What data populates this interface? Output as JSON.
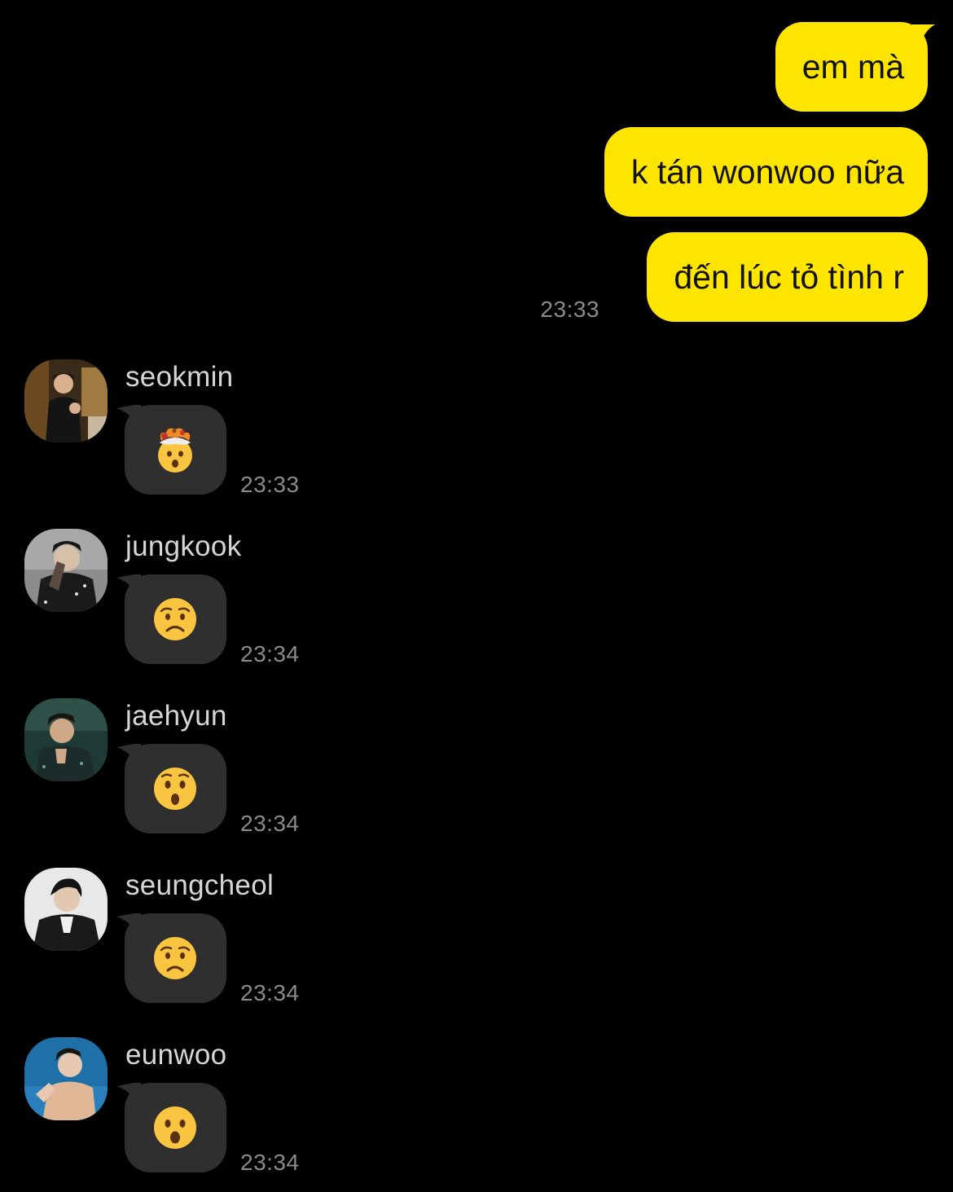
{
  "theme": {
    "background": "#000000",
    "outgoing_bubble": "#FEE500",
    "incoming_bubble": "#2F2F2F",
    "timestamp_color": "#8A8A8A"
  },
  "outgoing": {
    "messages": [
      {
        "text": "em mà"
      },
      {
        "text": "k tán wonwoo nữa"
      },
      {
        "text": "đến lúc tỏ tình r"
      }
    ],
    "time": "23:33"
  },
  "incoming": [
    {
      "sender": "seokmin",
      "emoji": "exploding-head-emoji",
      "time": "23:33"
    },
    {
      "sender": "jungkook",
      "emoji": "worried-face-emoji",
      "time": "23:34"
    },
    {
      "sender": "jaehyun",
      "emoji": "hushed-face-emoji",
      "time": "23:34"
    },
    {
      "sender": "seungcheol",
      "emoji": "worried-face-emoji",
      "time": "23:34"
    },
    {
      "sender": "eunwoo",
      "emoji": "open-mouth-face-emoji",
      "time": "23:34"
    }
  ]
}
